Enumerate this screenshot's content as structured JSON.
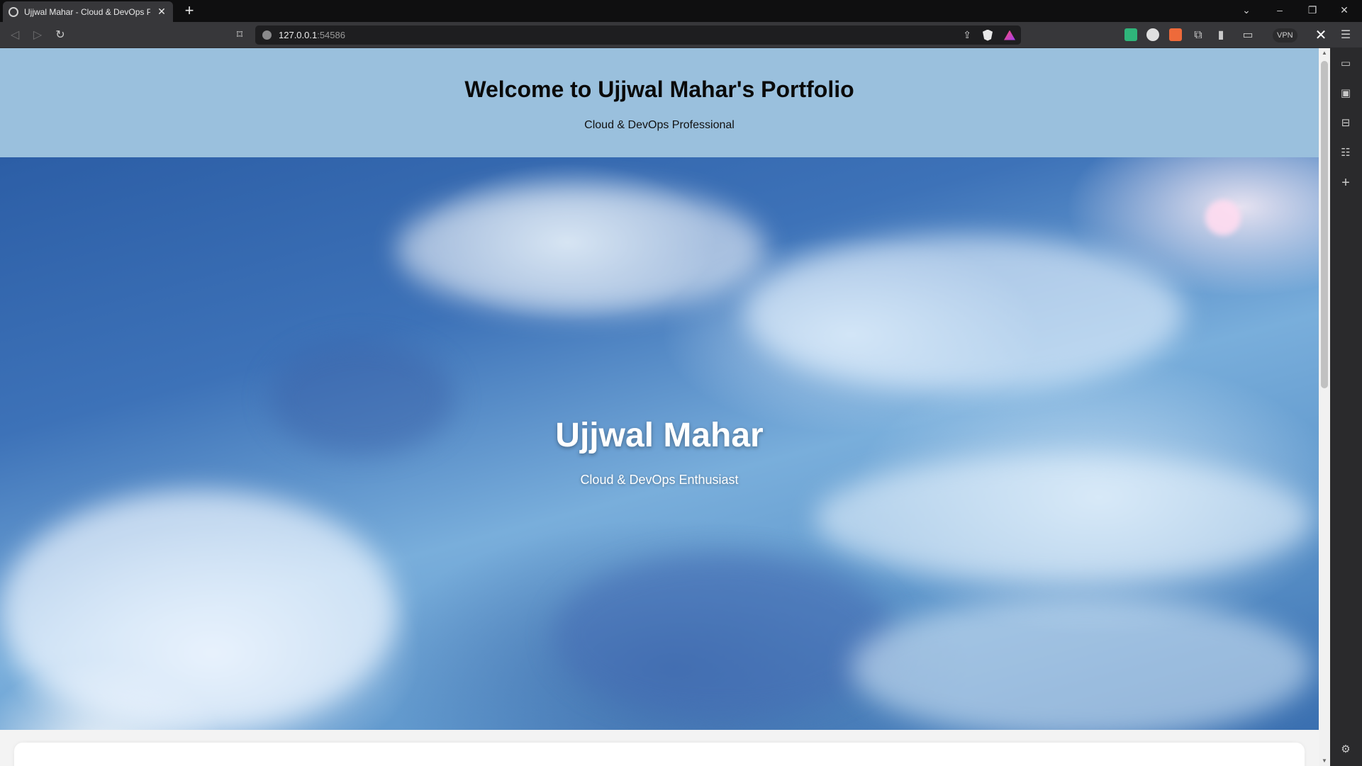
{
  "browser": {
    "tab_title": "Ujjwal Mahar - Cloud & DevOps P",
    "tab_close": "✕",
    "new_tab": "+",
    "window_controls": {
      "list": "⌄",
      "minimize": "–",
      "restore": "❐",
      "close": "✕"
    },
    "address_host": "127.0.0.1",
    "address_port": ":54586",
    "vpn_label": "VPN",
    "icons": {
      "back": "back-arrow-icon",
      "forward": "forward-arrow-icon",
      "reload": "reload-icon",
      "bookmark": "bookmark-icon",
      "share": "share-icon",
      "brave_shields": "brave-shield-icon",
      "brave_rewards": "brave-rewards-icon",
      "menu": "hamburger-menu-icon"
    }
  },
  "page": {
    "header_title": "Welcome to Ujjwal Mahar's Portfolio",
    "header_subtitle": "Cloud & DevOps Professional",
    "hero_name": "Ujjwal Mahar",
    "hero_tagline": "Cloud & DevOps Enthusiast"
  },
  "colors": {
    "header_bg": "#9ac0dd",
    "hero_sky": "#3d72b8"
  }
}
